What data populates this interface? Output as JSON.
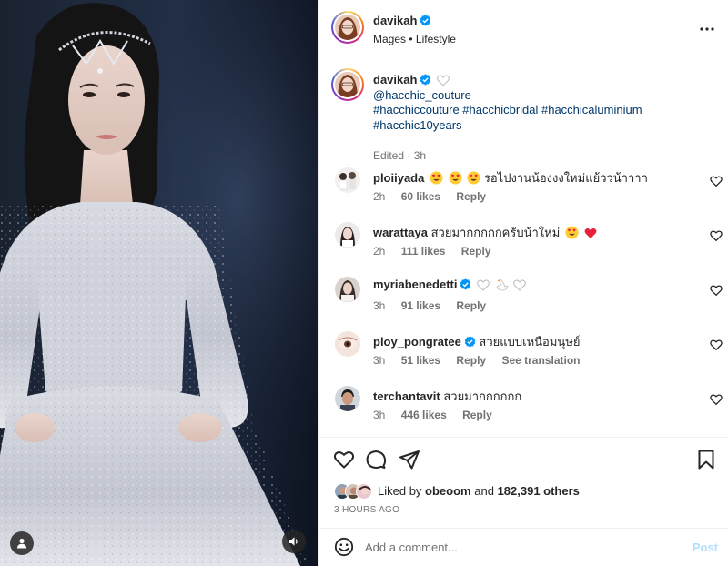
{
  "post": {
    "author": "davikah",
    "location": "Mages",
    "separator": "•",
    "category": "Lifestyle"
  },
  "caption": {
    "username": "davikah",
    "mention": "@hacchic_couture",
    "hashtags_line1": "#hacchiccouture #hacchicbridal #hacchicaluminium",
    "hashtags_line2": "#hacchic10years",
    "edited": "Edited · 3h"
  },
  "comments": [
    {
      "username": "ploiiyada",
      "text": "รอไปงานน้องงงใหม่แย้ววน้าาาา",
      "emojis": [
        "heart-eyes",
        "heart-eyes",
        "heart-eyes"
      ],
      "time": "2h",
      "likes": "60 likes",
      "reply": "Reply",
      "extra": "",
      "verified": false
    },
    {
      "username": "warattaya",
      "text": "สวยมากกกกกครับน้าใหม่",
      "emojis": [
        "heart-eyes",
        "red-heart"
      ],
      "time": "2h",
      "likes": "111 likes",
      "reply": "Reply",
      "extra": "",
      "verified": false
    },
    {
      "username": "myriabenedetti",
      "text": "",
      "emojis": [
        "white-heart",
        "swan",
        "white-heart"
      ],
      "time": "3h",
      "likes": "91 likes",
      "reply": "Reply",
      "extra": "",
      "verified": true
    },
    {
      "username": "ploy_pongratee",
      "text": "สวยแบบเหนือมนุษย์",
      "emojis": [],
      "time": "3h",
      "likes": "51 likes",
      "reply": "Reply",
      "extra": "See translation",
      "verified": true
    },
    {
      "username": "terchantavit",
      "text": "สวยมากกกกกก",
      "emojis": [],
      "time": "3h",
      "likes": "446 likes",
      "reply": "Reply",
      "extra": "",
      "verified": false
    }
  ],
  "likes": {
    "prefix": "Liked by",
    "user": "obeoom",
    "middle": "and",
    "count": "182,391 others"
  },
  "timestamp": "3 HOURS AGO",
  "add_comment": {
    "placeholder": "Add a comment...",
    "post_label": "Post"
  },
  "colors": {
    "verified": "#0095f6",
    "link": "#00376b",
    "muted": "#737373",
    "post_disabled": "#b2dffc"
  }
}
